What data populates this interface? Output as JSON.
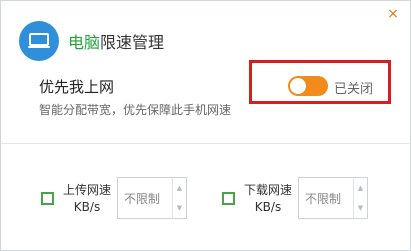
{
  "dialog": {
    "title_accent": "电脑",
    "title_rest": "限速管理",
    "close_glyph": "×"
  },
  "priority": {
    "title": "优先我上网",
    "description": "智能分配带宽，优先保障此手机网速",
    "toggle_state": "已关闭",
    "toggle_on": false
  },
  "upload": {
    "label_line1": "上传网速",
    "label_line2": "KB/s",
    "value": "不限制"
  },
  "download": {
    "label_line1": "下载网速",
    "label_line2": "KB/s",
    "value": "不限制"
  },
  "colors": {
    "accent_green": "#23a23a",
    "toggle_orange": "#f28a1c",
    "highlight_red": "#d21f1f",
    "icon_blue": "#2f8fd8"
  }
}
